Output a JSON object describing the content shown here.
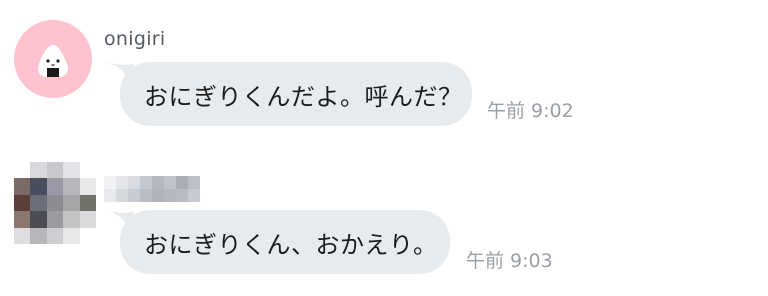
{
  "messages": [
    {
      "sender": "onigiri",
      "text": "おにぎりくんだよ。呼んだ？",
      "time": "午前 9:02",
      "avatar_icon": "onigiri-face-icon",
      "avatar_bg": "#ffc3d0"
    },
    {
      "sender": "",
      "text": "おにぎりくん、おかえり。",
      "time": "午前 9:03",
      "avatar_icon": "pixelated-avatar"
    }
  ],
  "colors": {
    "bubble_bg": "#e8ebee",
    "sender_text": "#555b63",
    "time_text": "#9a9fa6"
  }
}
